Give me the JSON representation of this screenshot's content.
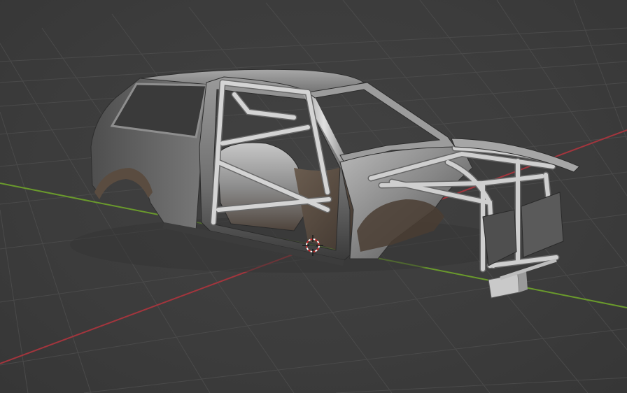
{
  "viewport": {
    "background_color": "#3d3d3d",
    "grid_color": "#4a4a4a",
    "x_axis_color": "#a3353d",
    "y_axis_color": "#6a9a2c"
  },
  "model": {
    "kind": "car body shell with roll cage and front tube frame",
    "body_color": "#8d8d8d",
    "tube_color": "#b8b8b8",
    "interior_color": "#5a4a3e"
  },
  "cursor_3d": {
    "icon": "3d-cursor-icon",
    "ring_color": "#c42a2a"
  }
}
